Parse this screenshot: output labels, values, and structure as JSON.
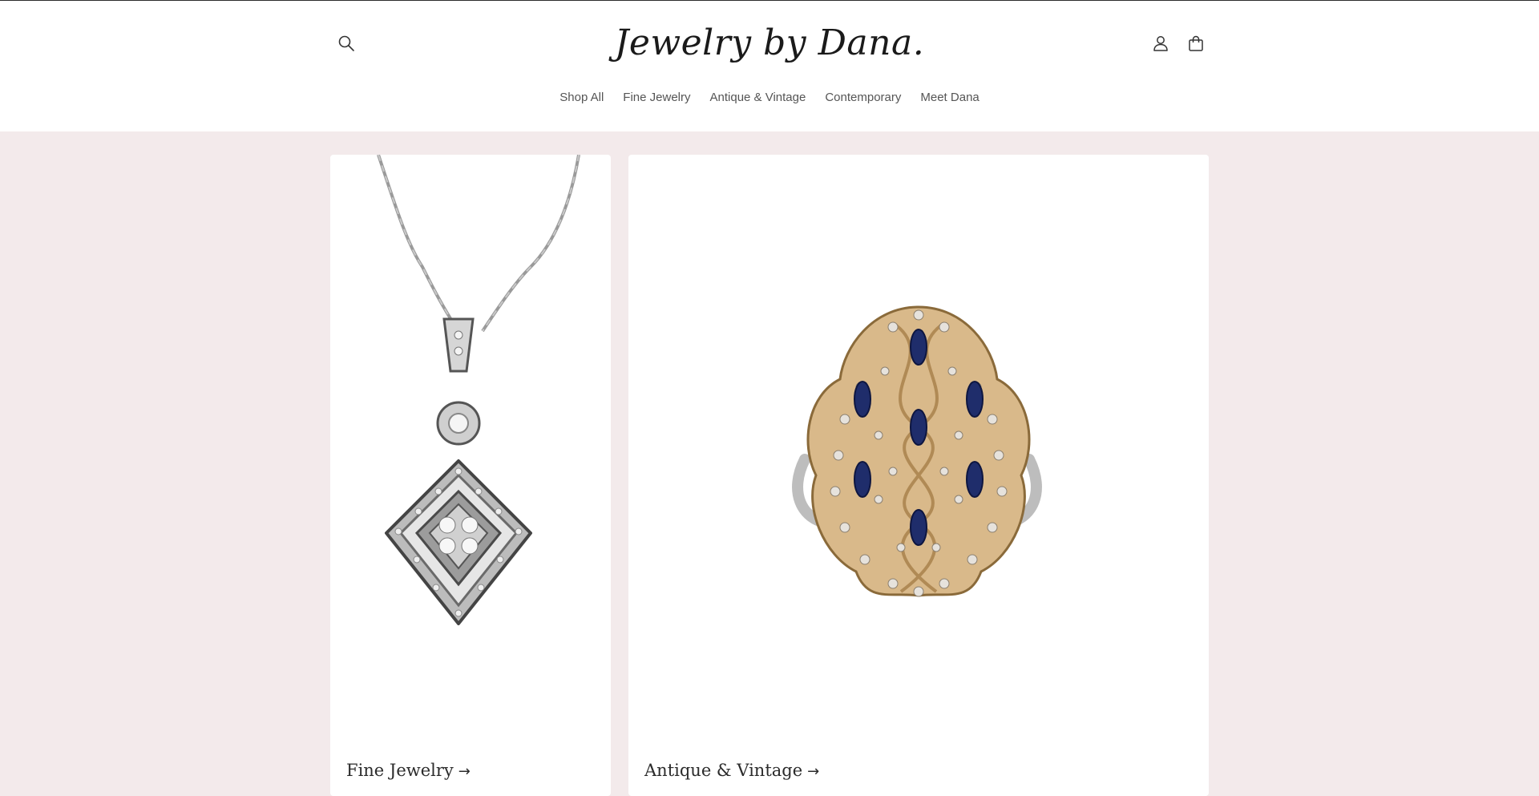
{
  "brand": {
    "logo_text": "Jewelry by Dana."
  },
  "header": {
    "icons": {
      "search": "search-icon",
      "account": "account-icon",
      "cart": "cart-icon"
    }
  },
  "nav": {
    "items": [
      "Shop All",
      "Fine Jewelry",
      "Antique & Vintage",
      "Contemporary",
      "Meet Dana"
    ]
  },
  "collections": [
    {
      "title": "Fine Jewelry",
      "arrow": "→"
    },
    {
      "title": "Antique & Vintage",
      "arrow": "→"
    }
  ],
  "colors": {
    "page_bg": "#f3eaeb",
    "header_bg": "#ffffff",
    "text": "#2b2b2b"
  }
}
